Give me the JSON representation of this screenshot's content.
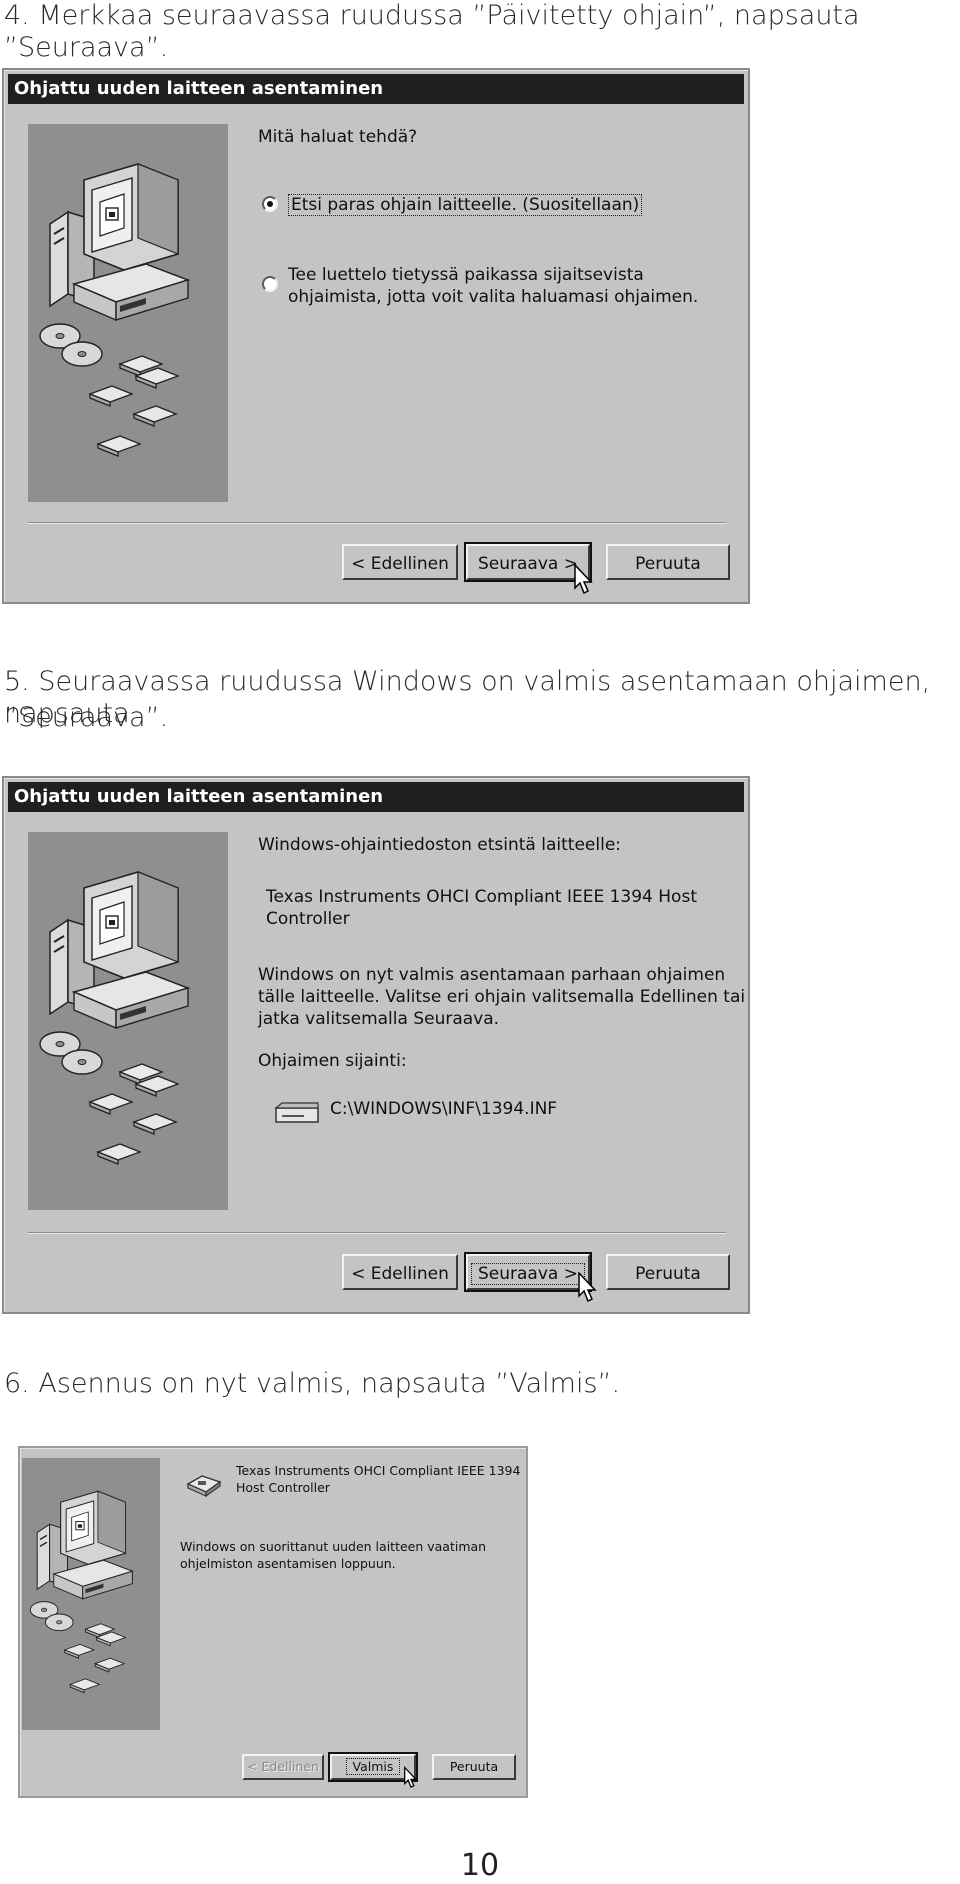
{
  "steps": {
    "s4": "4. Merkkaa seuraavassa ruudussa ”Päivitetty ohjain”, napsauta ”Seuraava”.",
    "s5_line1": "5. Seuraavassa ruudussa Windows on valmis asentamaan ohjaimen, napsauta",
    "s5_line2": "”Seuraava”.",
    "s6": "6. Asennus on nyt valmis, napsauta ”Valmis”."
  },
  "dialog1": {
    "title": "Ohjattu uuden laitteen asentaminen",
    "question": "Mitä haluat tehdä?",
    "option1": "Etsi paras ohjain laitteelle. (Suositellaan)",
    "option2_line1": "Tee luettelo tietyssä paikassa sijaitsevista",
    "option2_line2": "ohjaimista, jotta voit valita haluamasi ohjaimen.",
    "selected_option": 1,
    "back_label": "< Edellinen",
    "next_label": "Seuraava >",
    "cancel_label": "Peruuta"
  },
  "dialog2": {
    "title": "Ohjattu uuden laitteen asentaminen",
    "heading": "Windows-ohjaintiedoston etsintä laitteelle:",
    "device_line1": "Texas Instruments OHCI Compliant IEEE 1394 Host",
    "device_line2": "Controller",
    "body_line1": "Windows on nyt valmis asentamaan parhaan ohjaimen",
    "body_line2": "tälle laitteelle. Valitse eri ohjain valitsemalla Edellinen tai",
    "body_line3": "jatka valitsemalla Seuraava.",
    "location_label": "Ohjaimen sijainti:",
    "location_path": "C:\\WINDOWS\\INF\\1394.INF",
    "back_label": "< Edellinen",
    "next_label": "Seuraava >",
    "cancel_label": "Peruuta"
  },
  "dialog3": {
    "device_line1": "Texas Instruments OHCI Compliant IEEE 1394",
    "device_line2": "Host Controller",
    "body_line1": "Windows on suorittanut uuden laitteen vaatiman",
    "body_line2": "ohjelmiston asentamisen loppuun.",
    "back_label": "< Edellinen",
    "finish_label": "Valmis",
    "cancel_label": "Peruuta"
  },
  "page_number": "10"
}
